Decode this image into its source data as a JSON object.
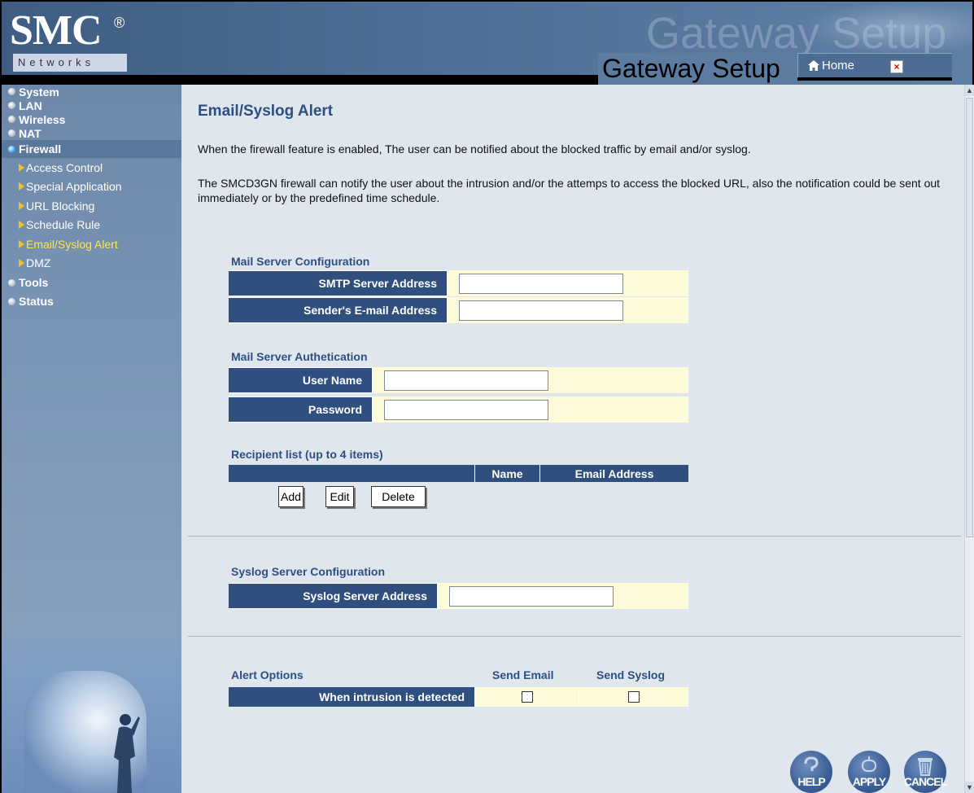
{
  "header": {
    "logo_text": "SMC",
    "logo_reg": "®",
    "logo_sub": "Networks",
    "watermark": "Gateway Setup",
    "title": "Gateway Setup",
    "home_label": "Home",
    "close_glyph": "×"
  },
  "sidebar": {
    "items": [
      {
        "label": "System"
      },
      {
        "label": "LAN"
      },
      {
        "label": "Wireless"
      },
      {
        "label": "NAT"
      },
      {
        "label": "Firewall",
        "subitems": [
          {
            "label": "Access Control"
          },
          {
            "label": "Special Application"
          },
          {
            "label": "URL Blocking"
          },
          {
            "label": "Schedule Rule"
          },
          {
            "label": "Email/Syslog Alert"
          },
          {
            "label": "DMZ"
          }
        ]
      },
      {
        "label": "Tools"
      },
      {
        "label": "Status"
      }
    ],
    "active": "Firewall",
    "current_subitem": "Email/Syslog Alert"
  },
  "main": {
    "title": "Email/Syslog Alert",
    "desc1": "When the firewall feature is enabled, The user can be notified about the blocked traffic by email and/or syslog.",
    "desc2": "The SMCD3GN firewall can notify the user about the intrusion and/or the attemps to access the blocked URL, also the notification could be sent out immediately or by the predefined time schedule.",
    "mail_server": {
      "heading": "Mail Server Configuration",
      "smtp_label": "SMTP Server Address",
      "smtp_value": "",
      "sender_label": "Sender's E-mail Address",
      "sender_value": ""
    },
    "mail_auth": {
      "heading": "Mail Server Authetication",
      "user_label": "User Name",
      "user_value": "",
      "password_label": "Password",
      "password_value": ""
    },
    "recipients": {
      "heading": "Recipient list (up to 4 items)",
      "columns": [
        "",
        "Name",
        "Email Address"
      ],
      "rows": [],
      "add_label": "Add",
      "edit_label": "Edit",
      "delete_label": "Delete"
    },
    "syslog": {
      "heading": "Syslog Server Configuration",
      "address_label": "Syslog Server Address",
      "address_value": ""
    },
    "alert_options": {
      "heading": "Alert Options",
      "col_email": "Send Email",
      "col_syslog": "Send Syslog",
      "row_label": "When intrusion is detected",
      "send_email_checked": false,
      "send_syslog_checked": false
    },
    "actions": {
      "help": "HELP",
      "apply": "APPLY",
      "cancel": "CANCEL"
    }
  },
  "colors": {
    "header_bg": "#4f6f96",
    "sidebar_bg": "#7b95b6",
    "content_bg": "#dfe6ee",
    "label_bg": "#2f4f7e",
    "cell_bg": "#fdfbd9",
    "title_color": "#2e4f82",
    "current_nav": "#ffe94a"
  }
}
